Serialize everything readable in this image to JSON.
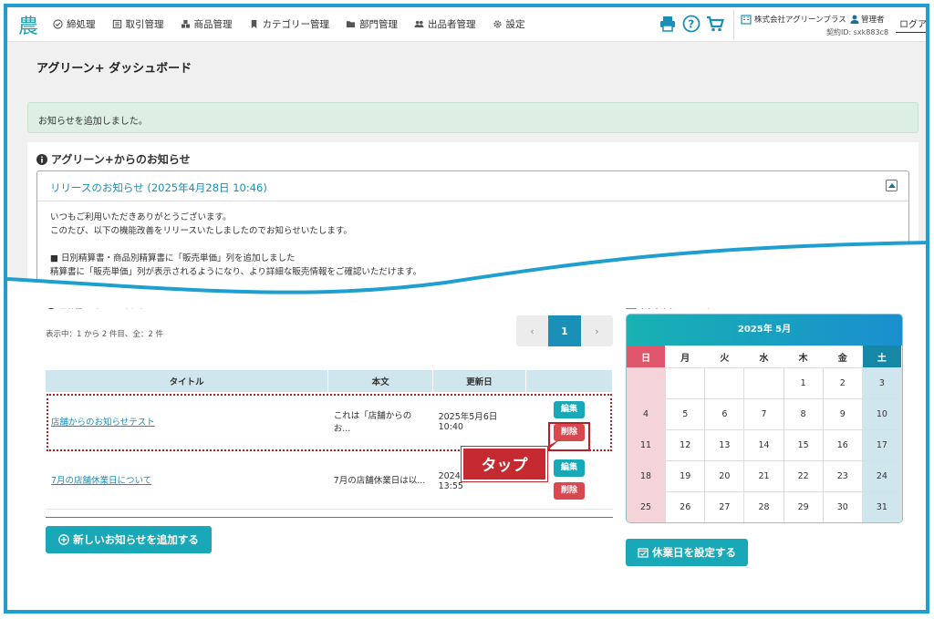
{
  "header": {
    "logo_text": "農",
    "nav": [
      {
        "label": "締処理",
        "icon": "check-circle-icon"
      },
      {
        "label": "取引管理",
        "icon": "ledger-icon"
      },
      {
        "label": "商品管理",
        "icon": "boxes-icon"
      },
      {
        "label": "カテゴリー管理",
        "icon": "bookmark-icon"
      },
      {
        "label": "部門管理",
        "icon": "folder-icon"
      },
      {
        "label": "出品者管理",
        "icon": "users-icon"
      },
      {
        "label": "設定",
        "icon": "gear-icon"
      }
    ],
    "company": "株式会社アグリーンプラス",
    "role": "管理者",
    "contract": "契約ID: sxk883c8",
    "logout": "ログアウト"
  },
  "dashboard_title": "アグリーン+ ダッシュボード",
  "alert_text": "お知らせを追加しました。",
  "agreen_notice": {
    "heading": "アグリーン+からのお知らせ",
    "release_title": "リリースのお知らせ (2025年4月28日 10:46)",
    "lines": [
      "いつもご利用いただきありがとうございます。",
      "このたび、以下の機能改善をリリースいたしましたのでお知らせいたします。",
      "",
      "■ 日別精算書・商品別精算書に「販売単価」列を追加しました",
      "精算書に「販売単価」列が表示されるようになり、より詳細な販売情報をご確認いただけます。"
    ]
  },
  "store_notice": {
    "heading": "店舗からのお知らせ",
    "count_text": "表示中：1 から 2 件目、全：2 件",
    "pager": {
      "prev": "‹",
      "current": "1",
      "next": "›"
    },
    "columns": [
      "タイトル",
      "本文",
      "更新日",
      ""
    ],
    "rows": [
      {
        "title": "店舗からのお知らせテスト",
        "body": "これは「店舗からのお...",
        "date": "2025年5月6日 10:40",
        "edit": "編集",
        "delete": "削除"
      },
      {
        "title": "7月の店舗休業日について",
        "body": "7月の店舗休業日は以...",
        "date": "2024年7月10日 13:55",
        "edit": "編集",
        "delete": "削除"
      }
    ],
    "add_button": "新しいお知らせを追加する",
    "tap_label": "タップ"
  },
  "calendar": {
    "heading": "営業日カレンダー",
    "month": "2025年 5月",
    "weekdays": [
      "日",
      "月",
      "火",
      "水",
      "木",
      "金",
      "土"
    ],
    "days": [
      "",
      "",
      "",
      "",
      "1",
      "2",
      "3",
      "4",
      "5",
      "6",
      "7",
      "8",
      "9",
      "10",
      "11",
      "12",
      "13",
      "14",
      "15",
      "16",
      "17",
      "18",
      "19",
      "20",
      "21",
      "22",
      "23",
      "24",
      "25",
      "26",
      "27",
      "28",
      "29",
      "30",
      "31"
    ],
    "holiday_button": "休業日を設定する"
  },
  "colors": {
    "accent": "#1a8fb8",
    "teal": "#19a8b8",
    "danger": "#d9474f",
    "frame": "#1e9fd0"
  }
}
